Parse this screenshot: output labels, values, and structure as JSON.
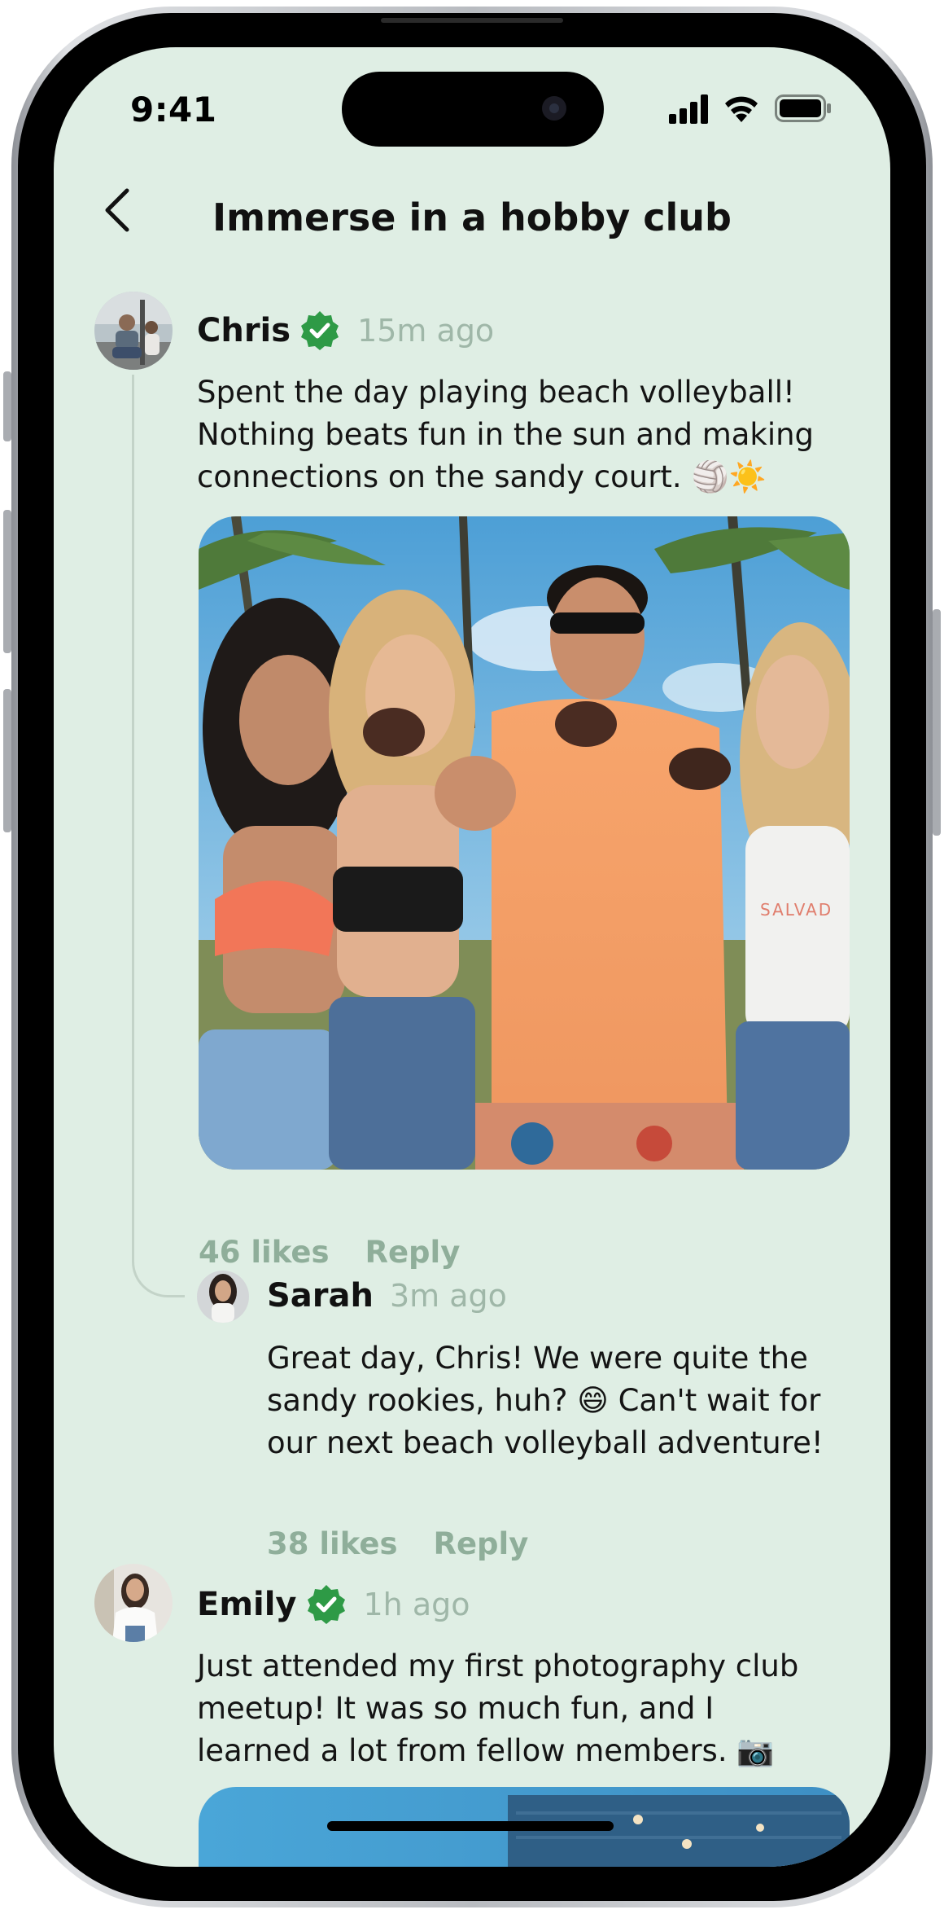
{
  "status_bar": {
    "time": "9:41"
  },
  "header": {
    "title": "Immerse in a hobby club"
  },
  "posts": [
    {
      "author": "Chris",
      "verified": true,
      "time": "15m ago",
      "text_lines": [
        "Spent the day playing beach volleyball!",
        "Nothing beats fun in the sun and making",
        "connections on the sandy court. 🏐☀️"
      ],
      "likes": "46 likes",
      "reply_label": "Reply",
      "reply": {
        "author": "Sarah",
        "time": "3m ago",
        "text_lines": [
          "Great day, Chris! We were quite the",
          "sandy rookies, huh? 😄 Can't wait for",
          "our next beach volleyball adventure!"
        ],
        "likes": "38 likes",
        "reply_label": "Reply"
      }
    },
    {
      "author": "Emily",
      "verified": true,
      "time": "1h ago",
      "text_lines": [
        "Just attended my first photography club",
        "meetup! It was so much fun, and I",
        "learned a lot from fellow members. 📷"
      ]
    }
  ],
  "colors": {
    "background": "#dfeee4",
    "verified_badge": "#2e9a46",
    "muted_green": "#8fae9a"
  }
}
